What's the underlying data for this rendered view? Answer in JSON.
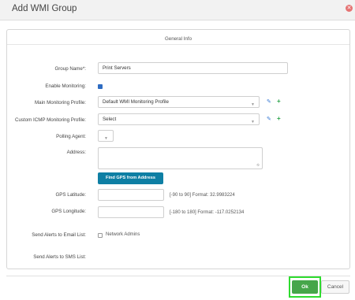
{
  "dialog": {
    "title": "Add WMI Group",
    "close_icon": "close-icon",
    "section_title": "General Info"
  },
  "form": {
    "group_name": {
      "label": "Group Name*:",
      "value": "Print Servers"
    },
    "enable_monitoring": {
      "label": "Enable Monitoring:",
      "checked": true
    },
    "main_profile": {
      "label": "Main Monitoring Profile:",
      "value": "Default WMI Monitoring Profile"
    },
    "icmp_profile": {
      "label": "Custom ICMP Monitoring Profile:",
      "value": "Select"
    },
    "polling_agent": {
      "label": "Polling Agent:",
      "value": ""
    },
    "address": {
      "label": "Address:",
      "value": ""
    },
    "find_gps_button": "Find GPS from Address",
    "gps_latitude": {
      "label": "GPS Latitude:",
      "value": "",
      "hint": "[-90 to 90]   Format: 32.9983224"
    },
    "gps_longitude": {
      "label": "GPS Longitude:",
      "value": "",
      "hint": "[-180 to 180]   Format: -117.0252134"
    },
    "email_list": {
      "label": "Send Alerts to Email List:",
      "option": "Network Admins",
      "checked": false
    },
    "sms_list": {
      "label": "Send Alerts to SMS List:"
    }
  },
  "footer": {
    "ok": "Ok",
    "cancel": "Cancel"
  },
  "colors": {
    "accent_blue": "#0e7fa4",
    "ok_green": "#46a64a",
    "highlight_green": "#2fdc2f"
  }
}
